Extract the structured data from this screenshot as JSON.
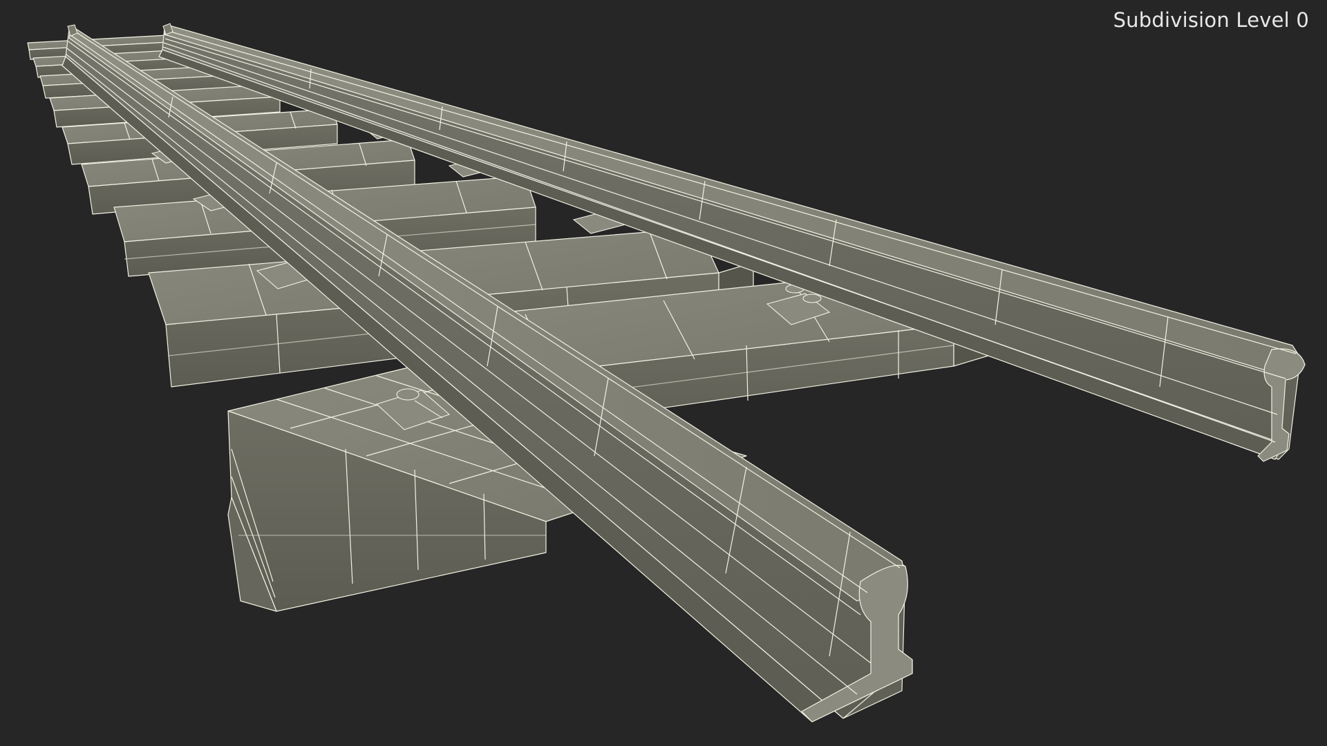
{
  "viewport": {
    "overlay_label": "Subdivision Level 0",
    "background_color": "#262626",
    "mesh_fill_color": "#7d7d70",
    "wire_color": "#f2f2e4"
  }
}
